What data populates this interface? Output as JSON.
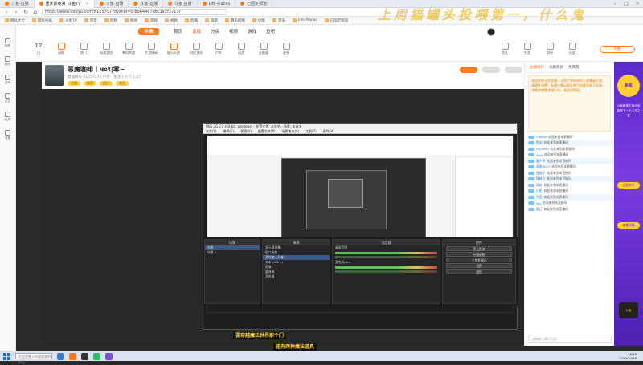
{
  "browser": {
    "tabs": [
      {
        "label": "斗鱼·直播"
      },
      {
        "label": "重庆妖夜第_斗鱼TV"
      },
      {
        "label": "斗鱼·直播"
      },
      {
        "label": "斗鱼·直播"
      },
      {
        "label": "斗鱼·直播"
      },
      {
        "label": "Life Places"
      },
      {
        "label": "已固定频道"
      }
    ],
    "url": "https://www.douyu.com/6125757?dyshid=0-bd64467d8c1e2f3713f",
    "bookmarks": [
      "网址大全",
      "网址导航",
      "斗鱼TV",
      "百度",
      "购物",
      "新闻",
      "游戏",
      "视频",
      "直播",
      "旅游",
      "腾讯视频",
      "优酷",
      "音乐",
      "Life Places",
      "已固定频道"
    ]
  },
  "banner": "上周猫罐头投喂第一，什么鬼",
  "leftbar": [
    {
      "label": "推荐"
    },
    {
      "label": "娱乐"
    },
    {
      "label": "游戏"
    },
    {
      "label": "关注"
    },
    {
      "label": "历史"
    },
    {
      "label": "设置"
    }
  ],
  "site": {
    "logo": "斗鱼",
    "nav": [
      "首页",
      "直播",
      "分类",
      "视频",
      "游戏",
      "鱼吧"
    ],
    "categories": [
      {
        "num": "12",
        "label": "日"
      },
      {
        "label": "直播"
      },
      {
        "label": "热门"
      },
      {
        "label": "网游竞技"
      },
      {
        "label": "单机热游"
      },
      {
        "label": "手游休闲"
      },
      {
        "label": "娱乐天地"
      },
      {
        "label": "科技文化"
      },
      {
        "label": "户外"
      },
      {
        "label": "语音"
      },
      {
        "label": "正能量"
      },
      {
        "label": "更多"
      }
    ],
    "right_icons": [
      {
        "label": "鱼丸"
      },
      {
        "label": "任务"
      },
      {
        "label": "消息"
      },
      {
        "label": "历史"
      }
    ],
    "open_live": "开播"
  },
  "room": {
    "title": "恶魔咖啡丨ч०९|零~",
    "meta": "直播间号 6125757  |  户外 · 生活  |  人气 1.2万",
    "tags": [
      "主播",
      "推荐",
      "热门",
      "关注"
    ]
  },
  "obs": {
    "title": "OBS 26.0.2 (64-bit, windows) - 配置文件: 未命名 - 场景: 未命名",
    "menu": [
      "文件(F)",
      "编辑(E)",
      "视图(V)",
      "配置文件(P)",
      "场景集合(S)",
      "工具(T)",
      "帮助(H)"
    ],
    "panels": {
      "scenes": {
        "title": "场景",
        "items": [
          "场景",
          "场景 2"
        ]
      },
      "sources": {
        "title": "来源",
        "items": [
          "显示器采集",
          "窗口采集",
          "音频输入采集",
          "文本 (GDI+)",
          "图像",
          "媒体源",
          "浏览器"
        ]
      },
      "mixer": {
        "title": "混音器",
        "items": [
          "桌面音频",
          "麦克风/Aux"
        ]
      },
      "controls": {
        "title": "控件",
        "items": [
          "停止推流",
          "开始录制",
          "工作室模式",
          "设置",
          "退出"
        ]
      }
    },
    "status": "LIVE: 00:48:07   REC: 00:00:00   CPU: 13.1%, 30.00 fps"
  },
  "subtitles": {
    "line1": "要穿越魔法世界那个门",
    "line2": "还有两种魔法道具"
  },
  "chat": {
    "tabs": [
      "主播排行",
      "贡献周榜",
      "贵宾席"
    ],
    "notice": "欢迎来到斗鱼直播，斗鱼严禁未成年人直播或打赏，请理性消费，若遇主播以刷礼物为由要求私下交易、涉黄涉赌等违规行为，请及时举报。",
    "messages": [
      {
        "name": "Cloudy",
        "text": "欢迎来到本直播间"
      },
      {
        "name": "鱼友",
        "text": "欢迎来到本直播间"
      },
      {
        "name": "FlyLevel",
        "text": "欢迎来到本直播间"
      },
      {
        "name": "Azai",
        "text": "欢迎来到本直播间"
      },
      {
        "name": "路人甲",
        "text": "欢迎来到本直播间"
      },
      {
        "name": "游客9527",
        "text": "欢迎来到本直播间"
      },
      {
        "name": "夜猫子",
        "text": "欢迎来到本直播间"
      },
      {
        "name": "咖啡豆",
        "text": "欢迎来到本直播间"
      },
      {
        "name": "萌新",
        "text": "欢迎来到本直播间"
      },
      {
        "name": "小鱼",
        "text": "欢迎来到本直播间"
      },
      {
        "name": "大佬",
        "text": "欢迎来到本直播间"
      },
      {
        "name": "Wu",
        "text": "欢迎来到本直播间"
      },
      {
        "name": "路过",
        "text": "欢迎来到本直播间"
      }
    ],
    "input_placeholder": "这里输入聊天内容"
  },
  "ad": {
    "badge": "新星",
    "text": "斗鱼新星主播计划 寻找下一个人气之星",
    "button1": "立即参与",
    "button2": "查看详情",
    "logo": "斗鱼"
  },
  "taskbar": {
    "search": "在这里输入你要搜索的内容",
    "time": "18:45",
    "date": "2020/10/26"
  },
  "colors": {
    "accent": "#ff5d23",
    "brand": "#ff7a1a",
    "ad_purple": "#5b2ac9"
  }
}
